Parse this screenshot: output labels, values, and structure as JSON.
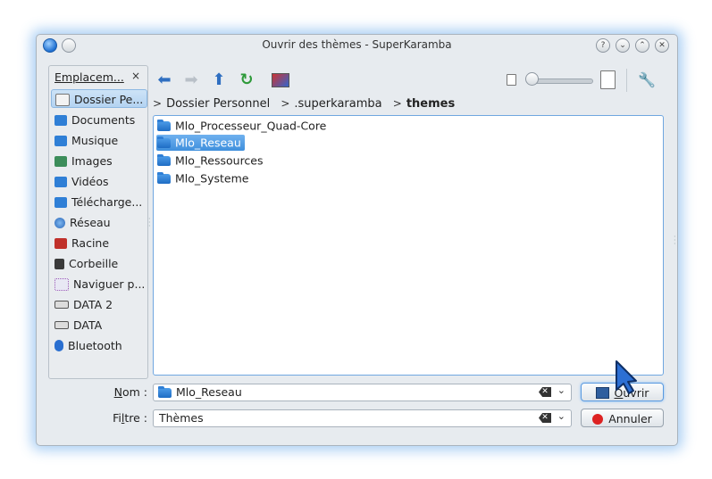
{
  "window": {
    "title": "Ouvrir des thèmes - SuperKaramba",
    "buttons": {
      "help": "?",
      "minimize": "⌄",
      "maximize": "⌃",
      "close": "✕"
    }
  },
  "places": {
    "header": "Emplacem...",
    "close": "×",
    "items": [
      {
        "label": "Dossier Pe...",
        "icon": "home-icon",
        "selected": true
      },
      {
        "label": "Documents",
        "icon": "folder-documents-icon"
      },
      {
        "label": "Musique",
        "icon": "folder-music-icon"
      },
      {
        "label": "Images",
        "icon": "folder-images-icon"
      },
      {
        "label": "Vidéos",
        "icon": "folder-videos-icon"
      },
      {
        "label": "Télécharge...",
        "icon": "folder-downloads-icon"
      },
      {
        "label": "Réseau",
        "icon": "network-icon"
      },
      {
        "label": "Racine",
        "icon": "root-folder-icon"
      },
      {
        "label": "Corbeille",
        "icon": "trash-icon"
      },
      {
        "label": "Naviguer p...",
        "icon": "network-browse-icon"
      },
      {
        "label": "DATA 2",
        "icon": "drive-icon"
      },
      {
        "label": "DATA",
        "icon": "drive-icon"
      },
      {
        "label": "Bluetooth",
        "icon": "bluetooth-icon"
      }
    ]
  },
  "toolbar": {
    "back": "back-arrow-icon",
    "forward": "forward-arrow-icon",
    "up": "up-arrow-icon",
    "reload": "reload-icon",
    "preview": "preview-icon",
    "options": "wrench-icon"
  },
  "breadcrumb": {
    "items": [
      "Dossier Personnel",
      ".superkaramba",
      "themes"
    ]
  },
  "files": [
    {
      "name": "Mlo_Processeur_Quad-Core",
      "selected": false
    },
    {
      "name": "Mlo_Reseau",
      "selected": true
    },
    {
      "name": "Mlo_Ressources",
      "selected": false
    },
    {
      "name": "Mlo_Systeme",
      "selected": false
    }
  ],
  "form": {
    "name_label_prefix": "N",
    "name_label_rest": "om :",
    "name_value": "Mlo_Reseau",
    "filter_label_prefix": "Fi",
    "filter_label_accel": "l",
    "filter_label_rest": "tre :",
    "filter_value": "Thèmes",
    "open_button_accel": "O",
    "open_button_rest": "uvrir",
    "cancel_button": "Annuler"
  },
  "colors": {
    "accent": "#3f8fdd",
    "window_bg": "#e7ebef",
    "glow": "#4696e6"
  }
}
